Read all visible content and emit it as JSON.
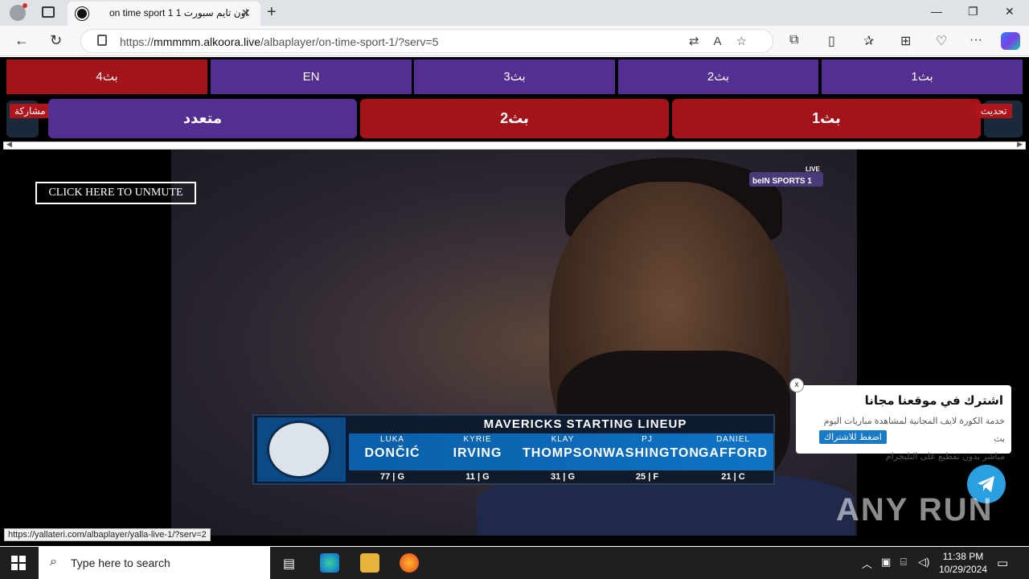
{
  "browser": {
    "tab": {
      "title": "on time sport 1 اون تايم سبورت 1",
      "close": "✕"
    },
    "new_tab": "+",
    "window_controls": [
      "—",
      "❐",
      "✕"
    ],
    "address": {
      "prefix": "https://",
      "host": "mmmmm.alkoora.live",
      "path": "/albaplayer/on-time-sport-1/?serv=5"
    },
    "icons": [
      "back-icon",
      "refresh-icon",
      "lock-icon",
      "translate-icon",
      "read-aloud-icon",
      "favorite-icon",
      "extensions-icon",
      "split-screen-icon",
      "favorites-icon",
      "collections-icon",
      "performance-icon",
      "more-icon",
      "copilot-icon"
    ]
  },
  "servers": {
    "row1": [
      "بث4",
      "EN",
      "بث3",
      "بث2",
      "بث1"
    ],
    "row1_colors": [
      "#a3131a",
      "#532f91",
      "#532f91",
      "#532f91",
      "#532f91"
    ],
    "row2": [
      "متعدد",
      "بث2",
      "بث1"
    ],
    "row2_colors": [
      "#532f91",
      "#a3131a",
      "#a3131a"
    ],
    "share_label": "مشاركة",
    "refresh_label": "تحديث"
  },
  "video": {
    "unmute_label": "CLICK HERE TO UNMUTE",
    "channel": "beIN SPORTS 1",
    "live": "LIVE",
    "lineup_title": "MAVERICKS STARTING LINEUP",
    "players": [
      {
        "first": "LUKA",
        "last": "DONČIĆ",
        "number": "77",
        "pos": "G"
      },
      {
        "first": "KYRIE",
        "last": "IRVING",
        "number": "11",
        "pos": "G"
      },
      {
        "first": "KLAY",
        "last": "THOMPSON",
        "number": "31",
        "pos": "G"
      },
      {
        "first": "PJ",
        "last": "WASHINGTON",
        "number": "25",
        "pos": "F"
      },
      {
        "first": "DANIEL",
        "last": "GAFFORD",
        "number": "21",
        "pos": "C"
      }
    ]
  },
  "popup": {
    "title": "اشترك في موقعنا مجانا",
    "desc_line1": "خدمة الكورة لايف المجانية لمشاهدة مباريات اليوم بث",
    "desc_line2": "مباشر بدون تقطيع على التليجرام",
    "button": "اضغط للاشتراك",
    "close": "x"
  },
  "watermark": "ANY RUN",
  "status_url": "https://yallateri.com/albaplayer/yalla-live-1/?serv=2",
  "taskbar": {
    "search_placeholder": "Type here to search",
    "time": "11:38 PM",
    "date": "10/29/2024"
  }
}
